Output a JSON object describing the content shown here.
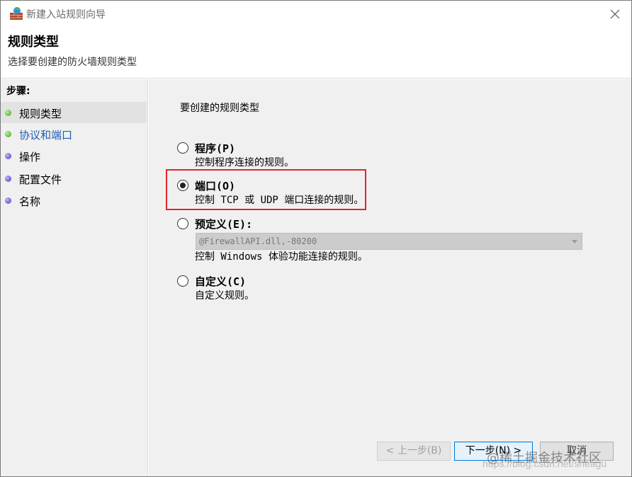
{
  "window": {
    "title": "新建入站规则向导",
    "colors": {
      "accent": "#0078d7",
      "highlight": "#e0262c",
      "link": "#1f5fb3"
    }
  },
  "header": {
    "title": "规则类型",
    "subtitle": "选择要创建的防火墙规则类型"
  },
  "sidebar": {
    "steps_label": "步骤:",
    "items": [
      {
        "label": "规则类型",
        "dot": "green",
        "current": true
      },
      {
        "label": "协议和端口",
        "dot": "green",
        "link": true
      },
      {
        "label": "操作",
        "dot": "purple"
      },
      {
        "label": "配置文件",
        "dot": "purple"
      },
      {
        "label": "名称",
        "dot": "purple"
      }
    ]
  },
  "main": {
    "prompt": "要创建的规则类型",
    "options": [
      {
        "label": "程序(P)",
        "desc": "控制程序连接的规则。",
        "checked": false
      },
      {
        "label": "端口(O)",
        "desc": "控制 TCP 或 UDP 端口连接的规则。",
        "checked": true
      },
      {
        "label": "预定义(E):",
        "desc": "控制 Windows 体验功能连接的规则。",
        "checked": false
      },
      {
        "label": "自定义(C)",
        "desc": "自定义规则。",
        "checked": false
      }
    ],
    "predefined_combo_value": "@FirewallAPI.dll,-80200"
  },
  "footer": {
    "back_label": "< 上一步(B)",
    "next_label": "下一步(N) >",
    "cancel_label": "取消"
  },
  "watermark": {
    "text": "@稀土掘金技术社区",
    "url": "https://blog.csdn.net/sheagu"
  }
}
